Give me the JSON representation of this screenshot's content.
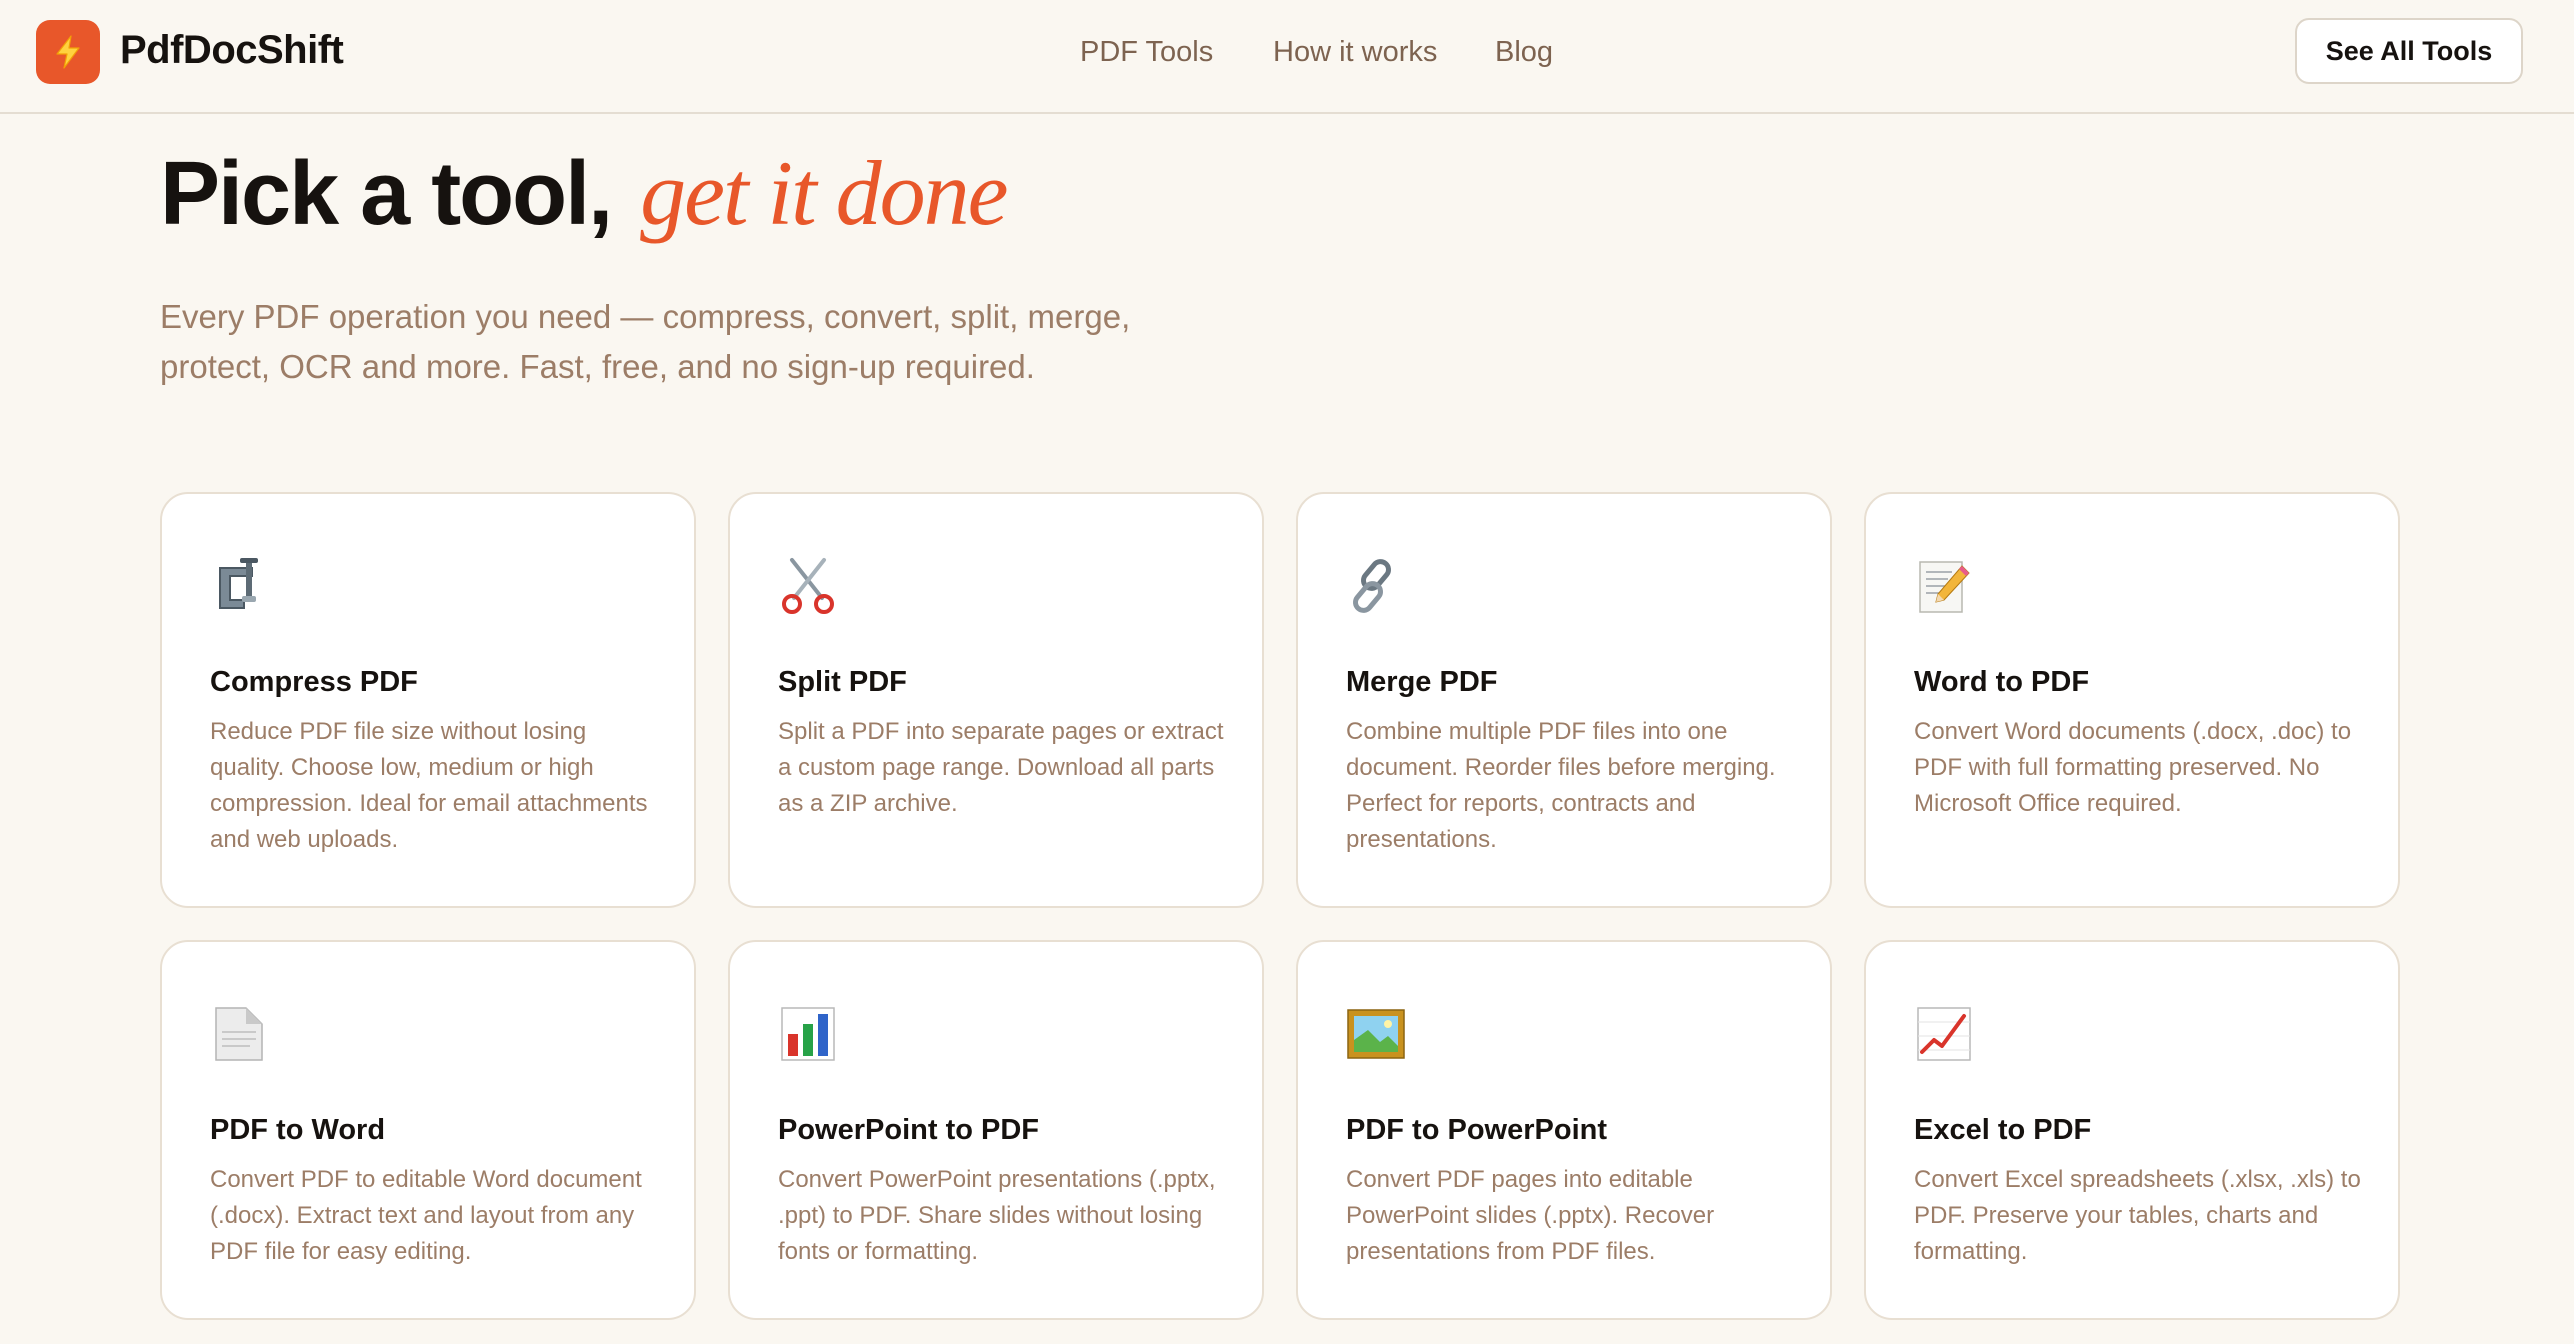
{
  "brand": {
    "name": "PdfDocShift",
    "logo_icon": "lightning-bolt-icon",
    "accent_color": "#e8572a"
  },
  "nav": {
    "links": [
      "PDF Tools",
      "How it works",
      "Blog"
    ],
    "cta_label": "See All Tools"
  },
  "hero": {
    "title_main": "Pick a tool,",
    "title_accent": "get it done",
    "subtitle": "Every PDF operation you need — compress, convert, split, merge, protect, OCR and more. Fast, free, and no sign-up required."
  },
  "tools": [
    {
      "icon": "clamp-icon",
      "title": "Compress PDF",
      "description": "Reduce PDF file size without losing quality. Choose low, medium or high compression. Ideal for email attachments and web uploads."
    },
    {
      "icon": "scissors-icon",
      "title": "Split PDF",
      "description": "Split a PDF into separate pages or extract a custom page range. Download all parts as a ZIP archive."
    },
    {
      "icon": "link-icon",
      "title": "Merge PDF",
      "description": "Combine multiple PDF files into one document. Reorder files before merging. Perfect for reports, contracts and presentations."
    },
    {
      "icon": "memo-icon",
      "title": "Word to PDF",
      "description": "Convert Word documents (.docx, .doc) to PDF with full formatting preserved. No Microsoft Office required."
    },
    {
      "icon": "document-icon",
      "title": "PDF to Word",
      "description": "Convert PDF to editable Word document (.docx). Extract text and layout from any PDF file for easy editing."
    },
    {
      "icon": "bar-chart-icon",
      "title": "PowerPoint to PDF",
      "description": "Convert PowerPoint presentations (.pptx, .ppt) to PDF. Share slides without losing fonts or formatting."
    },
    {
      "icon": "framed-picture-icon",
      "title": "PDF to PowerPoint",
      "description": "Convert PDF pages into editable PowerPoint slides (.pptx). Recover presentations from PDF files."
    },
    {
      "icon": "chart-increasing-icon",
      "title": "Excel to PDF",
      "description": "Convert Excel spreadsheets (.xlsx, .xls) to PDF. Preserve your tables, charts and formatting."
    }
  ]
}
